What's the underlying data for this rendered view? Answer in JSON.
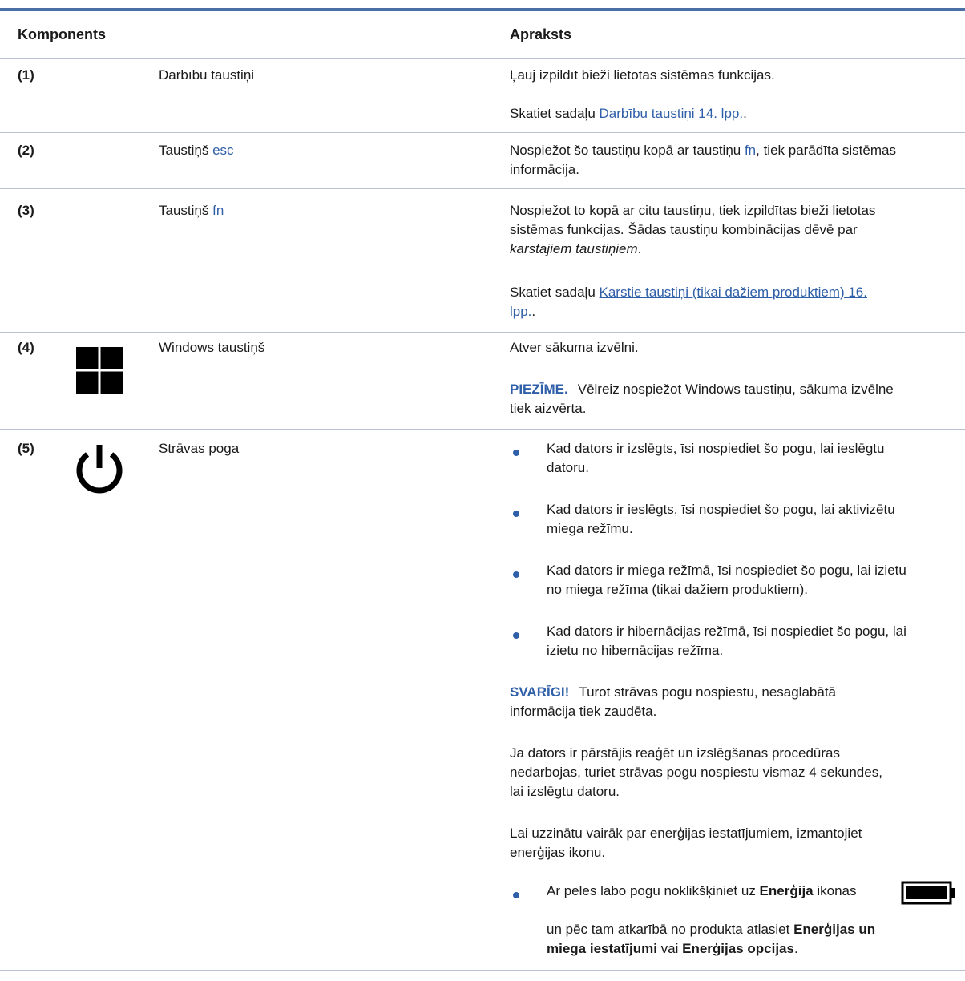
{
  "header": {
    "component": "Komponents",
    "description": "Apraksts"
  },
  "rows": [
    {
      "num": "(1)",
      "name": "Darbību taustiņi",
      "desc1": "Ļauj izpildīt bieži lietotas sistēmas funkcijas.",
      "ref_prefix": "Skatiet sadaļu ",
      "ref_link": "Darbību taustiņi 14. lpp.",
      "ref_suffix": "."
    },
    {
      "num": "(2)",
      "name_prefix": "Taustiņš ",
      "name_key": "esc",
      "desc_prefix": "Nospiežot šo taustiņu kopā ar taustiņu ",
      "desc_key": "fn",
      "desc_suffix_line1": ", tiek parādīta sistēmas",
      "desc_line2": "informācija."
    },
    {
      "num": "(3)",
      "name_prefix": "Taustiņš ",
      "name_key": "fn",
      "desc_line1": "Nospiežot to kopā ar citu taustiņu, tiek izpildītas bieži lietotas",
      "desc_line2": "sistēmas funkcijas. Šādas taustiņu kombinācijas dēvē par",
      "desc_line3": "karstajiem taustiņiem",
      "desc_line3_suffix": ".",
      "ref_prefix": "Skatiet sadaļu ",
      "ref_link_line1": "Karstie taustiņi (tikai dažiem produktiem) 16.",
      "ref_link_line2": "lpp.",
      "ref_suffix": "."
    },
    {
      "num": "(4)",
      "icon": "windows-icon",
      "name": "Windows taustiņš",
      "desc1": "Atver sākuma izvēlni.",
      "note_label": "PIEZĪME.",
      "note_line1": "Vēlreiz nospiežot Windows taustiņu, sākuma izvēlne",
      "note_line2": "tiek aizvērta."
    },
    {
      "num": "(5)",
      "icon": "power-icon",
      "name": "Strāvas poga",
      "bullets": [
        {
          "l1": "Kad dators ir izslēgts, īsi nospiediet šo pogu, lai ieslēgtu",
          "l2": "datoru."
        },
        {
          "l1": "Kad dators ir ieslēgts, īsi nospiediet šo pogu, lai aktivizētu",
          "l2": "miega režīmu."
        },
        {
          "l1": "Kad dators ir miega režīmā, īsi nospiediet šo pogu, lai izietu",
          "l2": "no miega režīma (tikai dažiem produktiem)."
        },
        {
          "l1": "Kad dators ir hibernācijas režīmā, īsi nospiediet šo pogu, lai",
          "l2": "izietu no hibernācijas režīma."
        }
      ],
      "important_label": "SVARĪGI!",
      "important_line1": "Turot strāvas pogu nospiestu, nesaglabātā",
      "important_line2": "informācija tiek zaudēta.",
      "para1_l1": "Ja dators ir pārstājis reaģēt un izslēgšanas procedūras",
      "para1_l2": "nedarbojas, turiet strāvas pogu nospiestu vismaz 4 sekundes,",
      "para1_l3": "lai izslēgtu datoru.",
      "para2_l1": "Lai uzzinātu vairāk par enerģijas iestatījumiem, izmantojiet",
      "para2_l2": "enerģijas ikonu.",
      "last_bullet_prefix": "Ar peles labo pogu noklikšķiniet uz ",
      "last_bullet_bold": "Enerģija",
      "last_bullet_suffix": " ikonas",
      "last_bullet_icon": "battery-icon",
      "last_l2_prefix": "un pēc tam atkarībā no produkta atlasiet ",
      "last_l2_bold": "Enerģijas un",
      "last_l3_bold": "miega iestatījumi",
      "last_l3_mid": " vai ",
      "last_l3_bold2": "Enerģijas opcijas",
      "last_l3_suffix": "."
    }
  ]
}
